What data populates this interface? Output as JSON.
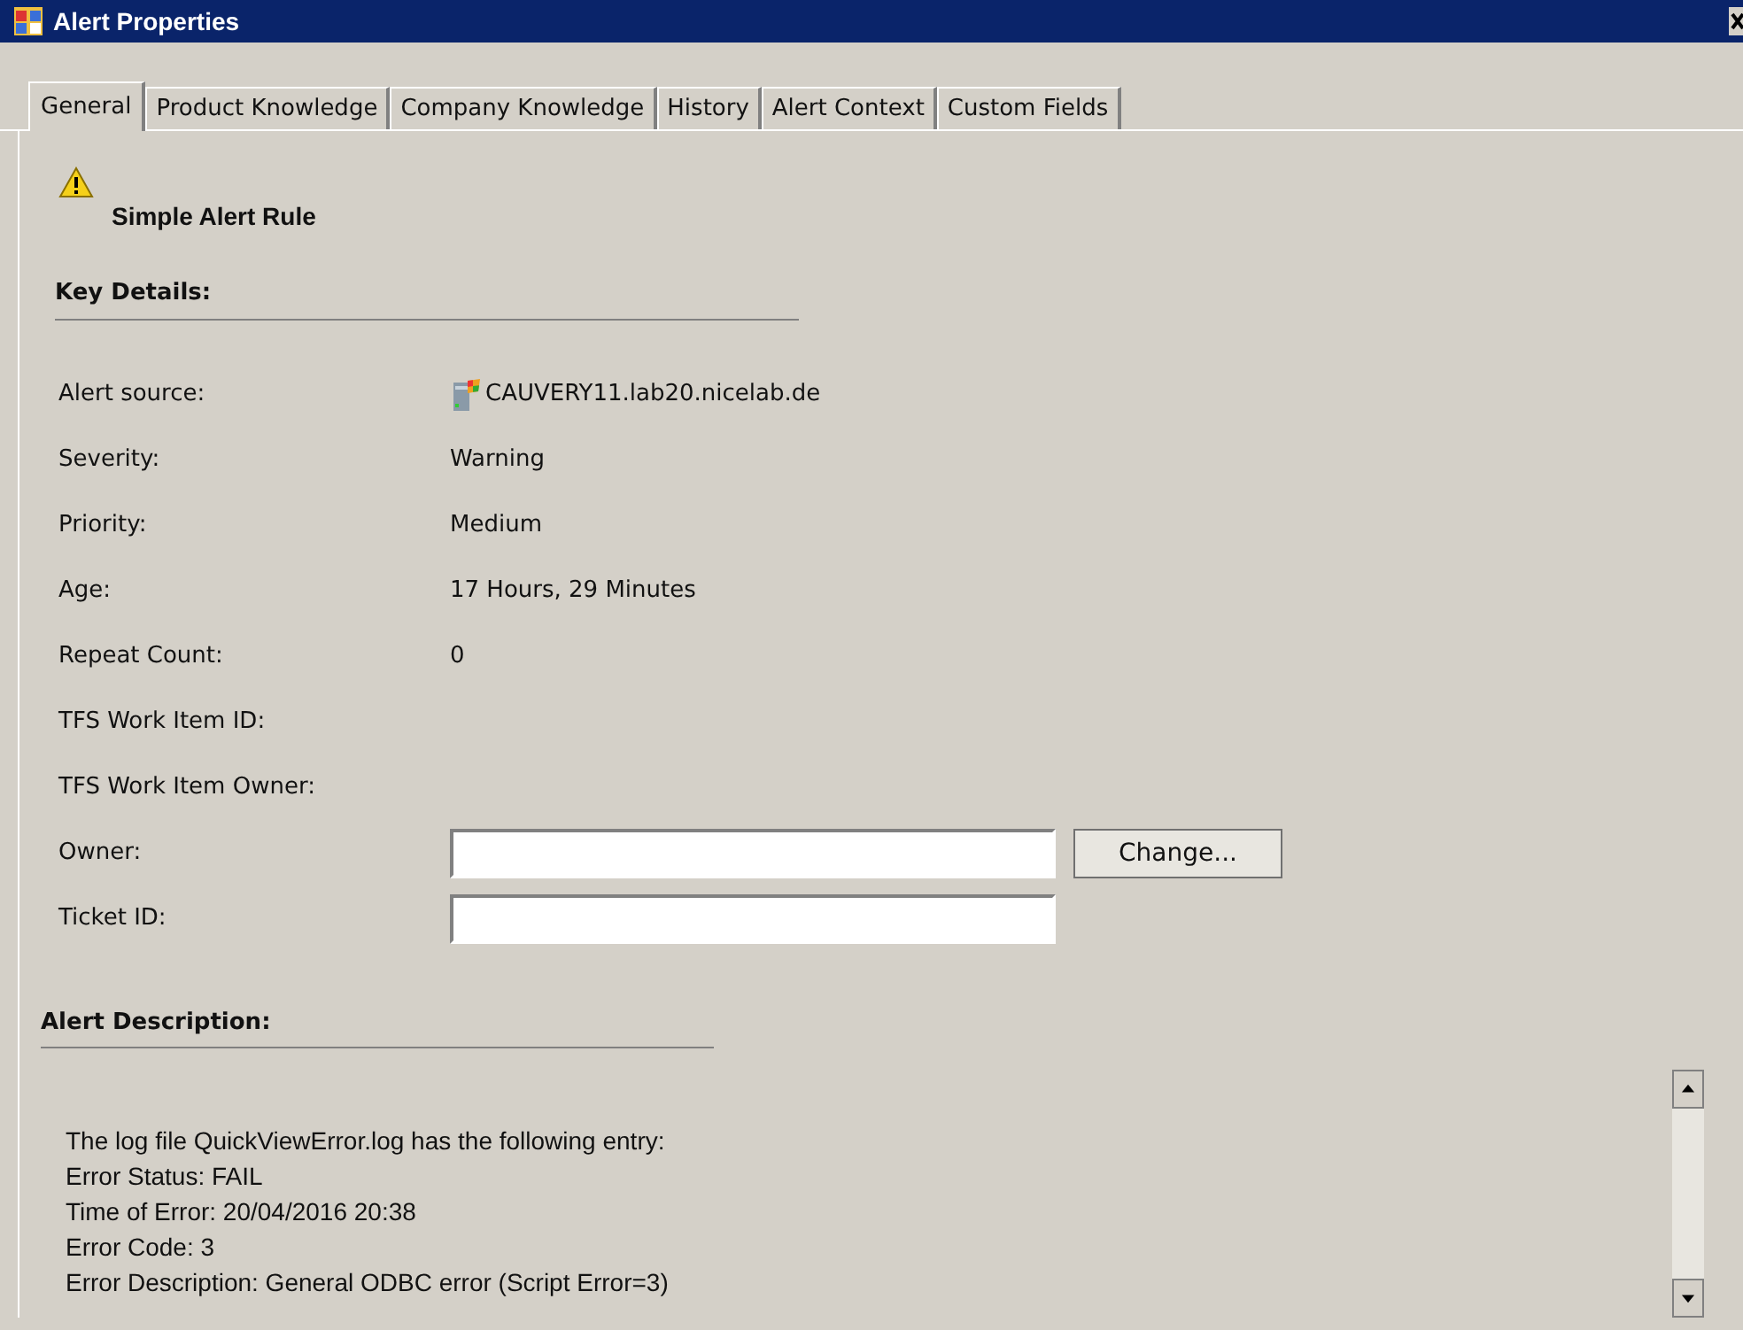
{
  "window": {
    "title": "Alert Properties"
  },
  "tabs": [
    {
      "label": "General",
      "selected": true
    },
    {
      "label": "Product Knowledge",
      "selected": false
    },
    {
      "label": "Company Knowledge",
      "selected": false
    },
    {
      "label": "History",
      "selected": false
    },
    {
      "label": "Alert Context",
      "selected": false
    },
    {
      "label": "Custom Fields",
      "selected": false
    }
  ],
  "alert": {
    "name": "Simple Alert Rule"
  },
  "key_details": {
    "heading": "Key Details:",
    "rows": [
      {
        "label": "Alert source:",
        "value": "CAUVERY11.lab20.nicelab.de",
        "kind": "source"
      },
      {
        "label": "Severity:",
        "value": "Warning",
        "kind": "text"
      },
      {
        "label": "Priority:",
        "value": "Medium",
        "kind": "text"
      },
      {
        "label": "Age:",
        "value": "17 Hours, 29 Minutes",
        "kind": "text"
      },
      {
        "label": "Repeat Count:",
        "value": "0",
        "kind": "text"
      },
      {
        "label": "TFS Work Item ID:",
        "kind": "text"
      },
      {
        "label": "TFS Work Item Owner:",
        "kind": "text"
      },
      {
        "label": "Owner:",
        "kind": "field",
        "button": "Change..."
      },
      {
        "label": "Ticket ID:",
        "kind": "field"
      }
    ]
  },
  "description": {
    "heading": "Alert Description:",
    "lines": [
      "The log file QuickViewError.log has the following entry:",
      "Error Status: FAIL",
      "Time of Error: 20/04/2016 20:38",
      "Error Code: 3",
      "Error Description: General ODBC error (Script Error=3)"
    ]
  }
}
